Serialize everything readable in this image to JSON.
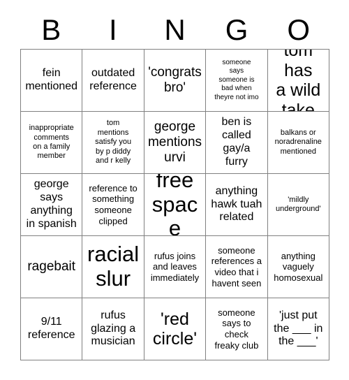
{
  "header": {
    "letters": [
      "B",
      "I",
      "N",
      "G",
      "O"
    ]
  },
  "grid": {
    "rows": [
      {
        "cells": [
          {
            "text": "fein\nmentioned",
            "size": "fs-md"
          },
          {
            "text": "outdated\nreference",
            "size": "fs-md"
          },
          {
            "text": "'congrats\nbro'",
            "size": "fs-lg"
          },
          {
            "text": "someone\nsays\nsomeone is\nbad when\ntheyre not imo",
            "size": "fs-xxs"
          },
          {
            "text": "tom has\na wild\ntake",
            "size": "fs-xl"
          }
        ]
      },
      {
        "cells": [
          {
            "text": "inappropriate\ncomments\non a family\nmember",
            "size": "fs-xs"
          },
          {
            "text": "tom\nmentions\nsatisfy you\nby p diddy\nand r kelly",
            "size": "fs-xs"
          },
          {
            "text": "george\nmentions\nurvi",
            "size": "fs-lg"
          },
          {
            "text": "ben is\ncalled\ngay/a\nfurry",
            "size": "fs-md"
          },
          {
            "text": "balkans or\nnoradrenaline\nmentioned",
            "size": "fs-xs"
          }
        ]
      },
      {
        "cells": [
          {
            "text": "george\nsays\nanything\nin spanish",
            "size": "fs-md"
          },
          {
            "text": "reference to\nsomething\nsomeone\nclipped",
            "size": "fs-sm"
          },
          {
            "text": "free\nspace",
            "size": "fs-xxl"
          },
          {
            "text": "anything\nhawk tuah\nrelated",
            "size": "fs-md"
          },
          {
            "text": "'mildly\nunderground'",
            "size": "fs-xs"
          }
        ]
      },
      {
        "cells": [
          {
            "text": "ragebait",
            "size": "fs-lg"
          },
          {
            "text": "racial\nslur",
            "size": "fs-xxl"
          },
          {
            "text": "rufus joins\nand leaves\nimmediately",
            "size": "fs-sm"
          },
          {
            "text": "someone\nreferences a\nvideo that i\nhavent seen",
            "size": "fs-sm"
          },
          {
            "text": "anything\nvaguely\nhomosexual",
            "size": "fs-sm"
          }
        ]
      },
      {
        "cells": [
          {
            "text": "9/11\nreference",
            "size": "fs-md"
          },
          {
            "text": "rufus\nglazing a\nmusician",
            "size": "fs-md"
          },
          {
            "text": "'red\ncircle'",
            "size": "fs-xl"
          },
          {
            "text": "someone\nsays to\ncheck\nfreaky club",
            "size": "fs-sm"
          },
          {
            "text": "'just put\nthe ___ in\nthe ___'",
            "size": "fs-md"
          }
        ]
      }
    ]
  }
}
